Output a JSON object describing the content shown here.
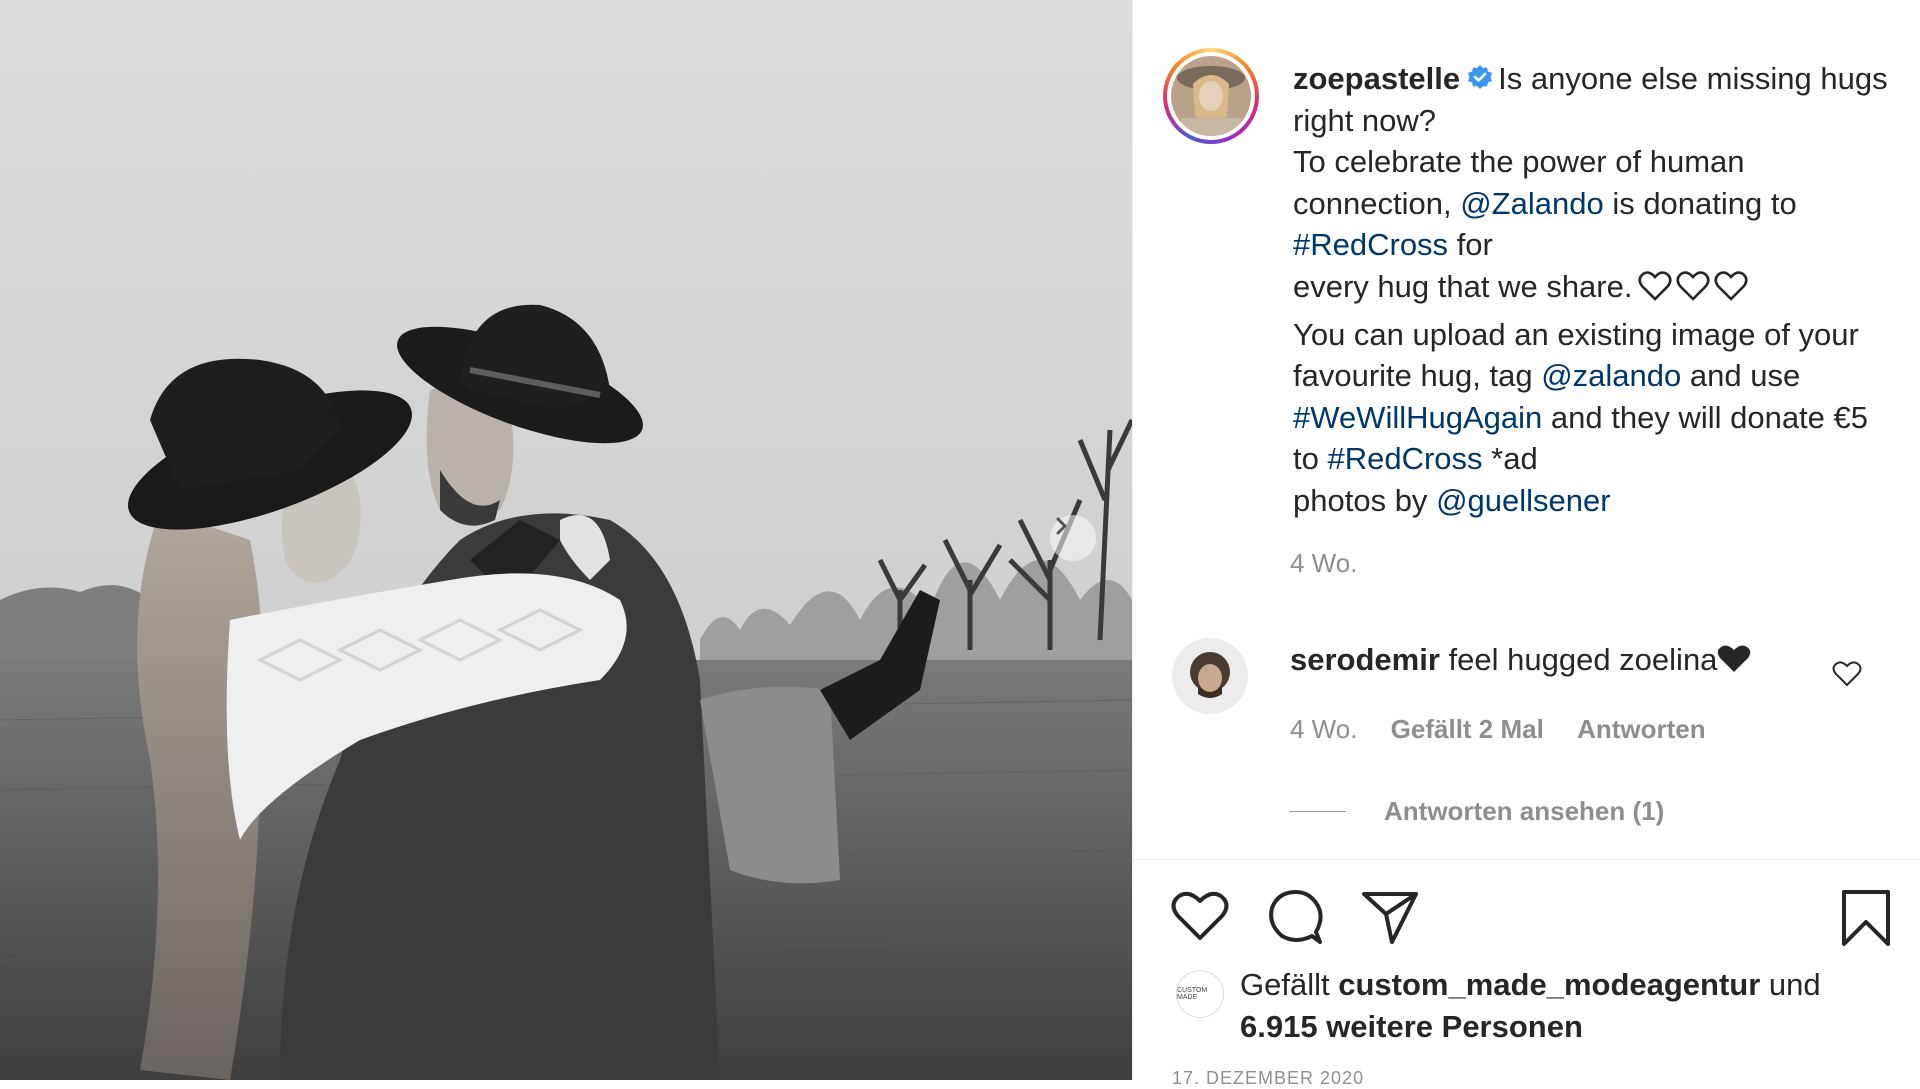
{
  "post": {
    "username": "zoepastelle",
    "caption": {
      "p1": "Is anyone else missing hugs right now?",
      "p2": "To celebrate the power of human connection,",
      "mention_zalando": "@Zalando",
      "p3": "is donating to",
      "tag_redcross": "#RedCross",
      "p4": "for",
      "p5": "every hug that we share.",
      "p6": "You can upload an existing image of your favourite hug, tag",
      "mention_zalando2": "@zalando",
      "p7": "and use",
      "tag_wewillhugagain": "#WeWillHugAgain",
      "p8": "and they will donate €5 to",
      "tag_redcross2": "#RedCross",
      "p9": "*ad",
      "p10": "photos by",
      "mention_guellsener": "@guellsener"
    },
    "time": "4 Wo.",
    "date": "17. DEZEMBER 2020"
  },
  "comment": {
    "username": "serodemir",
    "text": "feel hugged zoelina",
    "time": "4 Wo.",
    "likes": "Gefällt 2 Mal",
    "reply": "Antworten",
    "view_replies": "Antworten ansehen (1)"
  },
  "likes": {
    "prefix": "Gefällt",
    "user": "custom_made_modeagentur",
    "middle": "und",
    "others": "6.915 weitere Personen",
    "mini_avatar_text": "CUSTOM MADE"
  },
  "icons": {
    "verified": "verified-badge-icon",
    "next": "chevron-right-icon",
    "like": "heart-icon",
    "comment": "comment-bubble-icon",
    "share": "paper-plane-icon",
    "save": "bookmark-icon"
  },
  "colors": {
    "link": "#00376b",
    "verified": "#3897f0",
    "muted": "#8e8e8e",
    "text": "#262626"
  }
}
